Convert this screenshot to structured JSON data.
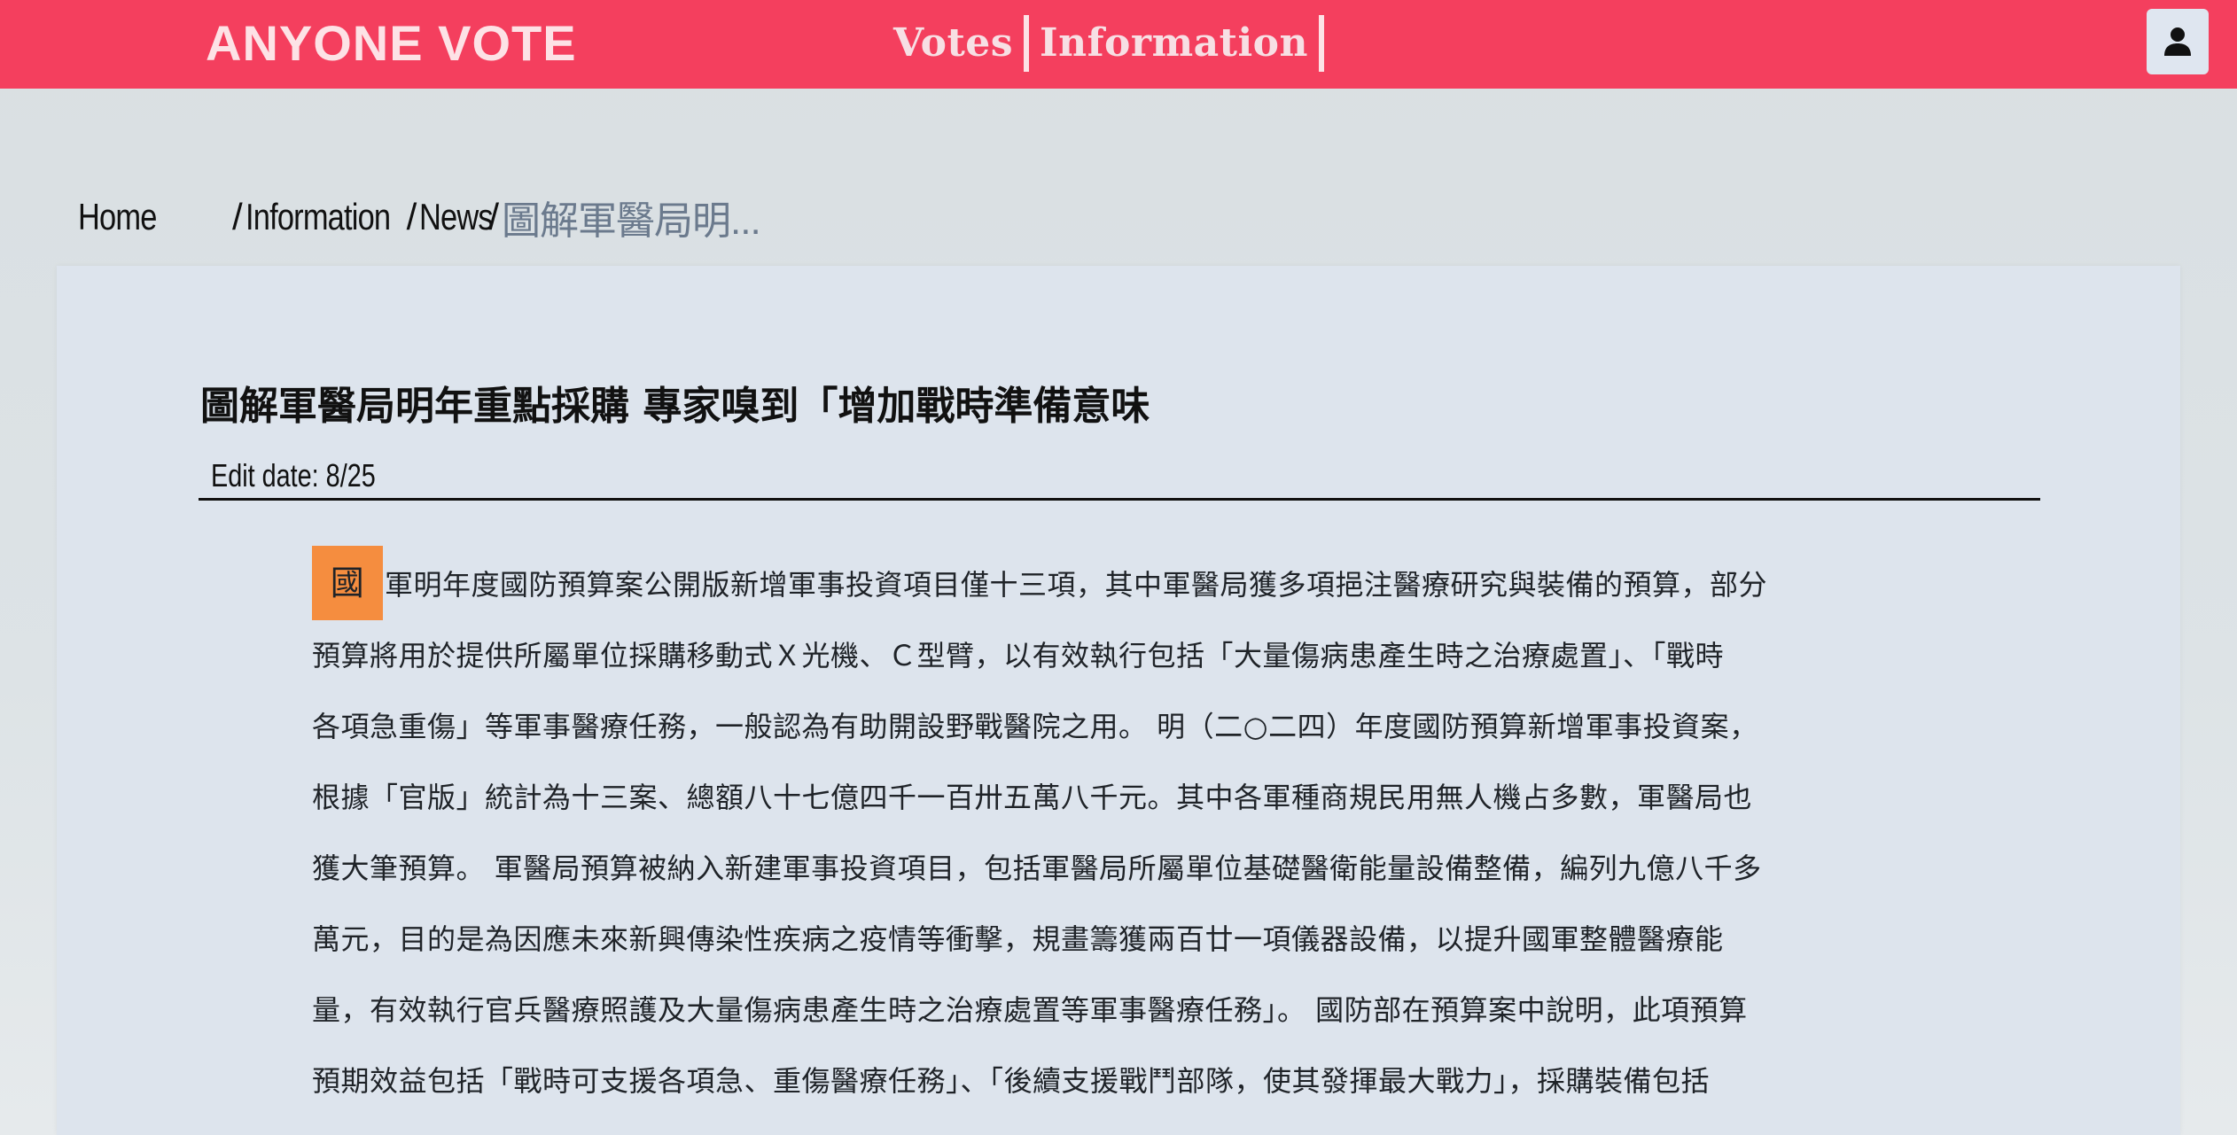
{
  "navbar": {
    "brand": "ANYONE VOTE",
    "links": [
      "Votes",
      "Information"
    ],
    "colors": {
      "bar": "#f43f5e",
      "brand_text": "#fde2e6"
    },
    "user_icon": "user-icon"
  },
  "breadcrumb": {
    "items": [
      "Home",
      "Information",
      "News"
    ],
    "separator": "/",
    "current": "圖解軍醫局明..."
  },
  "article": {
    "title": "圖解軍醫局明年重點採購 專家嗅到「增加戰時準備意味",
    "edit_date": "Edit date: 8/25",
    "dropcap": "國",
    "dropcap_color": "#f58d3f",
    "lines": [
      "軍明年度國防預算案公開版新增軍事投資項目僅十三項，其中軍醫局獲多項挹注醫療研究與裝備的預算，部分",
      "預算將用於提供所屬單位採購移動式Ｘ光機、Ｃ型臂，以有效執行包括「大量傷病患產生時之治療處置」、「戰時",
      "各項急重傷」等軍事醫療任務，一般認為有助開設野戰醫院之用。 明（二○二四）年度國防預算新增軍事投資案，",
      "根據「官版」統計為十三案、總額八十七億四千一百卅五萬八千元。其中各軍種商規民用無人機占多數，軍醫局也",
      "獲大筆預算。 軍醫局預算被納入新建軍事投資項目，包括軍醫局所屬單位基礎醫衛能量設備整備，編列九億八千多",
      "萬元，目的是為因應未來新興傳染性疾病之疫情等衝擊，規畫籌獲兩百廿一項儀器設備，以提升國軍整體醫療能",
      "量，有效執行官兵醫療照護及大量傷病患產生時之治療處置等軍事醫療任務」。 國防部在預算案中說明，此項預算",
      "預期效益包括「戰時可支援各項急、重傷醫療任務」、「後續支援戰鬥部隊，使其發揮最大戰力」，採購裝備包括"
    ]
  }
}
